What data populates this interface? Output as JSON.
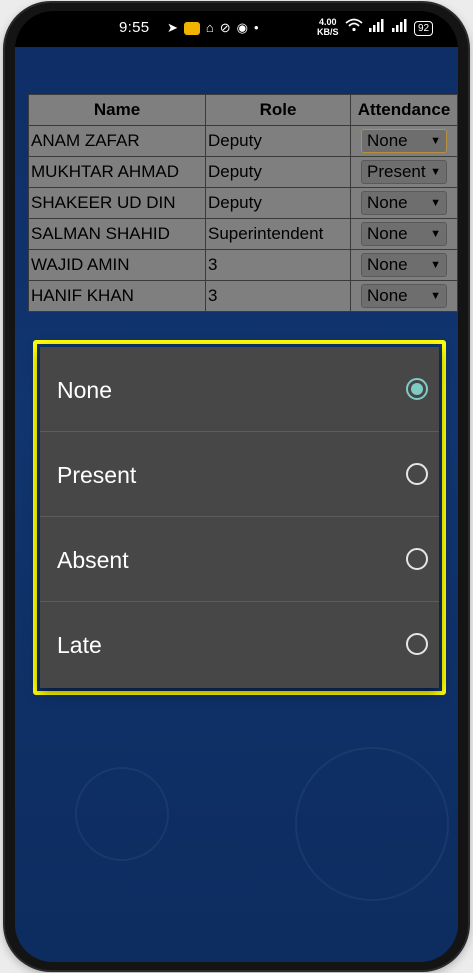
{
  "status_bar": {
    "time": "9:55",
    "net_speed_value": "4.00",
    "net_speed_unit": "KB/S",
    "battery": "92",
    "icons": [
      "telegram-icon",
      "app-icon",
      "notification-icon",
      "data-saver-icon",
      "record-icon",
      "dot-icon",
      "wifi-icon",
      "signal-icon",
      "signal-icon",
      "battery-icon"
    ]
  },
  "table": {
    "headers": {
      "name": "Name",
      "role": "Role",
      "attendance": "Attendance"
    },
    "rows": [
      {
        "name": "ANAM ZAFAR",
        "role": "Deputy",
        "attendance": "None"
      },
      {
        "name": "MUKHTAR AHMAD",
        "role": "Deputy",
        "attendance": "Present"
      },
      {
        "name": "SHAKEER UD DIN",
        "role": "Deputy",
        "attendance": "None"
      },
      {
        "name": "SALMAN SHAHID",
        "role": "Superintendent",
        "attendance": "None"
      },
      {
        "name": "WAJID AMIN",
        "role": "3",
        "attendance": "None"
      },
      {
        "name": "HANIF KHAN",
        "role": "3",
        "attendance": "None"
      }
    ]
  },
  "dialog": {
    "options": [
      {
        "label": "None",
        "selected": true
      },
      {
        "label": "Present",
        "selected": false
      },
      {
        "label": "Absent",
        "selected": false
      },
      {
        "label": "Late",
        "selected": false
      }
    ]
  },
  "colors": {
    "background": "#0f2e68",
    "table_bg": "#7f7f7f",
    "dialog_bg": "#474747",
    "highlight": "#ffff00",
    "radio_accent": "#80cbc4"
  }
}
